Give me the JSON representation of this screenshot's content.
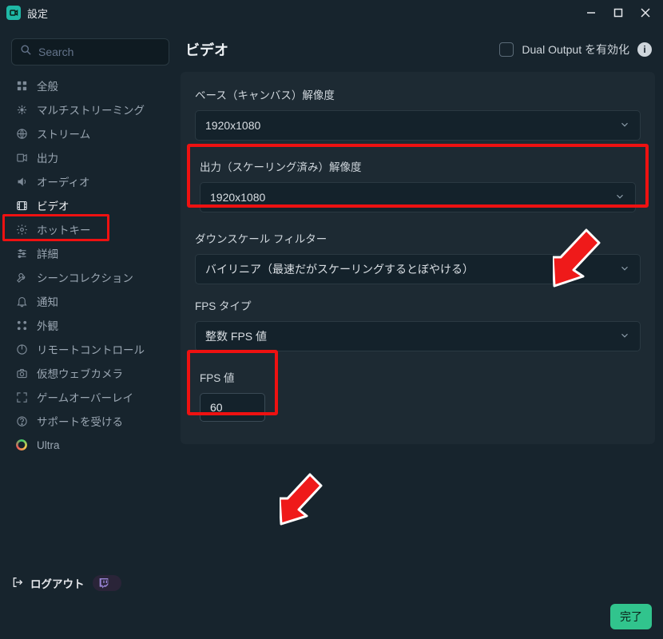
{
  "titlebar": {
    "title": "設定"
  },
  "search": {
    "placeholder": "Search"
  },
  "sidebar": {
    "items": [
      {
        "label": "全般"
      },
      {
        "label": "マルチストリーミング"
      },
      {
        "label": "ストリーム"
      },
      {
        "label": "出力"
      },
      {
        "label": "オーディオ"
      },
      {
        "label": "ビデオ"
      },
      {
        "label": "ホットキー"
      },
      {
        "label": "詳細"
      },
      {
        "label": "シーンコレクション"
      },
      {
        "label": "通知"
      },
      {
        "label": "外観"
      },
      {
        "label": "リモートコントロール"
      },
      {
        "label": "仮想ウェブカメラ"
      },
      {
        "label": "ゲームオーバーレイ"
      },
      {
        "label": "サポートを受ける"
      },
      {
        "label": "Ultra"
      }
    ]
  },
  "header": {
    "page_title": "ビデオ",
    "dual_output_label": "Dual Output を有効化",
    "info_glyph": "i"
  },
  "video": {
    "base": {
      "label": "ベース（キャンバス）解像度",
      "value": "1920x1080"
    },
    "output": {
      "label": "出力（スケーリング済み）解像度",
      "value": "1920x1080"
    },
    "downscale": {
      "label": "ダウンスケール フィルター",
      "value": "バイリニア（最速だがスケーリングするとぼやける）"
    },
    "fps_type": {
      "label": "FPS タイプ",
      "value": "整数 FPS 値"
    },
    "fps_value": {
      "label": "FPS 値",
      "value": "60"
    }
  },
  "footer": {
    "logout": "ログアウト",
    "done": "完了"
  }
}
